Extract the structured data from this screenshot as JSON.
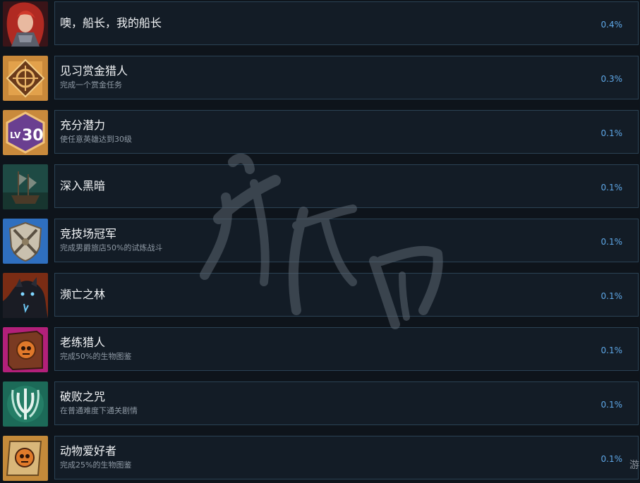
{
  "achievements": [
    {
      "icon": "captain-portrait-icon",
      "title": "噢，船长，我的船长",
      "desc": "",
      "percent": "0.4%"
    },
    {
      "icon": "bounty-target-icon",
      "title": "见习赏金猎人",
      "desc": "完成一个赏金任务",
      "percent": "0.3%"
    },
    {
      "icon": "level-30-badge-icon",
      "title": "充分潜力",
      "desc": "使任意英雄达到30级",
      "percent": "0.1%"
    },
    {
      "icon": "ghost-ship-icon",
      "title": "深入黑暗",
      "desc": "",
      "percent": "0.1%"
    },
    {
      "icon": "arena-shield-swords-icon",
      "title": "竞技场冠军",
      "desc": "完成男爵旅店50%的试炼战斗",
      "percent": "0.1%"
    },
    {
      "icon": "dark-beast-icon",
      "title": "濒亡之林",
      "desc": "",
      "percent": "0.1%"
    },
    {
      "icon": "skull-bestiary-book-icon",
      "title": "老练猎人",
      "desc": "完成50%的生物图鉴",
      "percent": "0.1%"
    },
    {
      "icon": "broken-trident-icon",
      "title": "破败之咒",
      "desc": "在普通难度下通关剧情",
      "percent": "0.1%"
    },
    {
      "icon": "skull-scroll-icon",
      "title": "动物爱好者",
      "desc": "完成25%的生物图鉴",
      "percent": "0.1%"
    }
  ],
  "corner_text": "游",
  "colors": {
    "background": "#0e141b",
    "panel": "#131c26",
    "border": "#2b4254",
    "percent": "#5fa8e8"
  }
}
